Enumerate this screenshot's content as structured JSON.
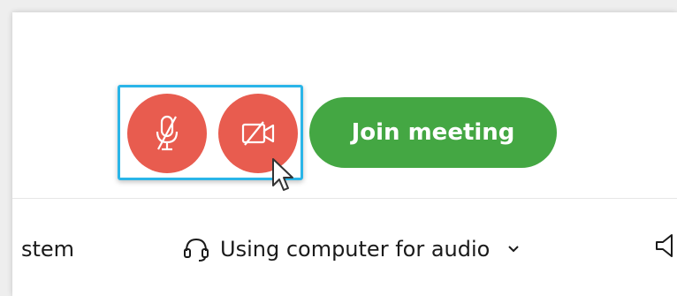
{
  "meeting": {
    "join_label": "Join meeting",
    "audio_label": "Using computer for audio",
    "partial_left_label": "stem"
  },
  "icons": {
    "mute": "microphone-off-icon",
    "video": "video-off-icon",
    "headset": "headset-icon",
    "dropdown": "chevron-down-icon",
    "speaker": "speaker-icon",
    "pointer": "mouse-cursor-icon"
  },
  "colors": {
    "mute_button": "#e85c4f",
    "join_button": "#44a743",
    "highlight": "#2ab5e8"
  }
}
